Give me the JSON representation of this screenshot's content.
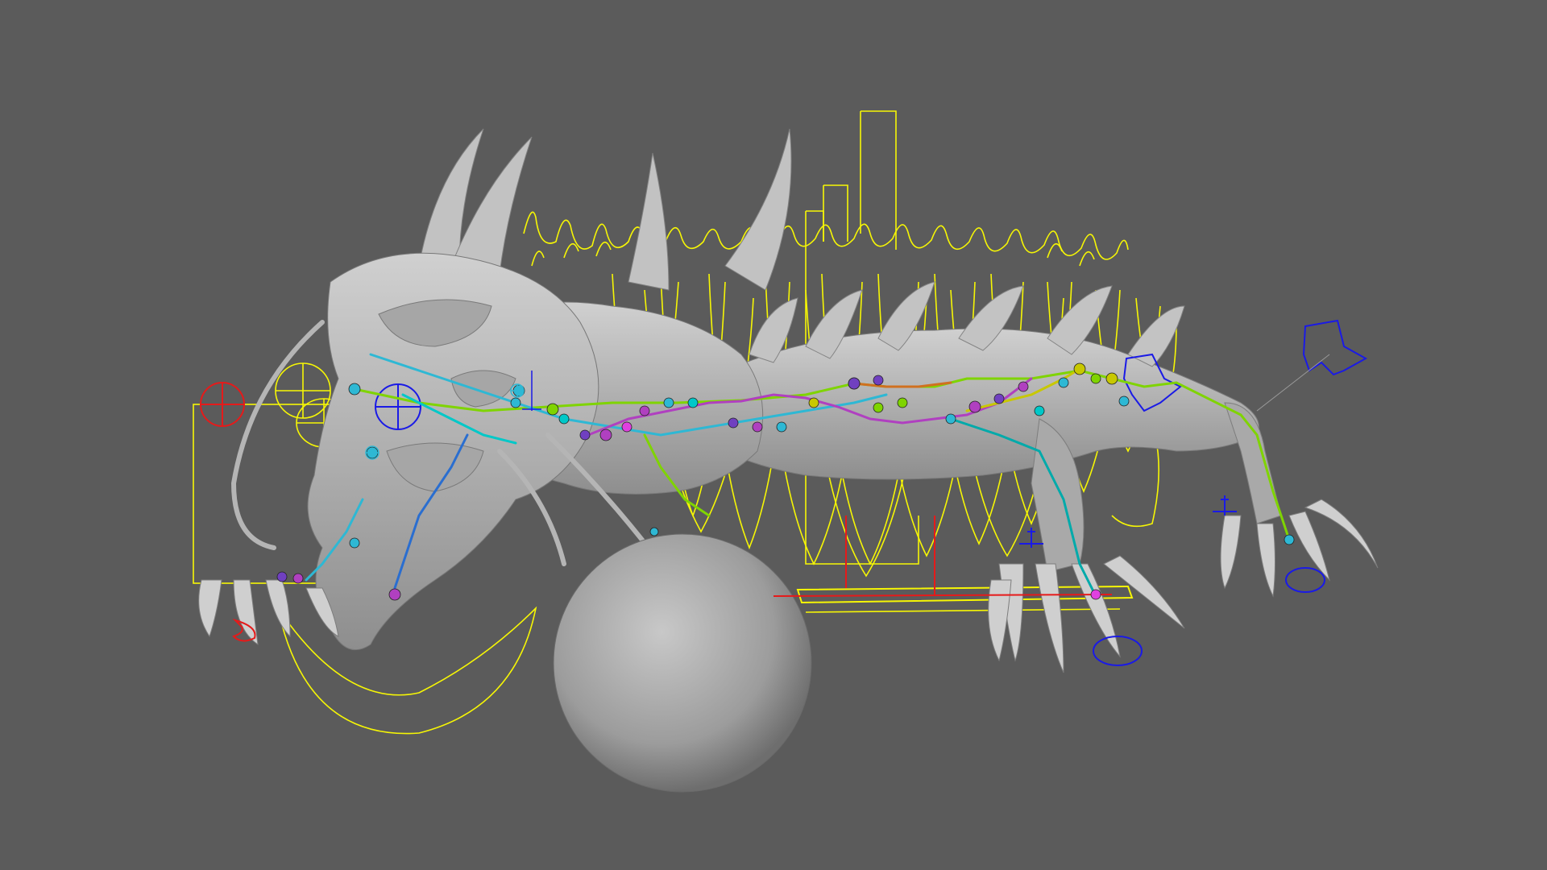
{
  "viewport": {
    "background_color": "#5b5b5b",
    "mesh_color": "#b9b9b9",
    "mesh_shadow_color": "#8a8a8a",
    "mesh_highlight_color": "#dcdcdc"
  },
  "controls": {
    "fk_ik_curve_color": "#ffff00",
    "left_side_color": "#1a1ae6",
    "right_side_color": "#e61a1a",
    "spine_joint_colors": [
      "#00c8c8",
      "#2eb8d4",
      "#7fd400",
      "#c8c800",
      "#b040c0",
      "#e040e0",
      "#00aaaa"
    ],
    "icons": [
      "locator-icon",
      "move-arrows-icon",
      "pole-vector-icon",
      "curve-control-icon"
    ]
  }
}
